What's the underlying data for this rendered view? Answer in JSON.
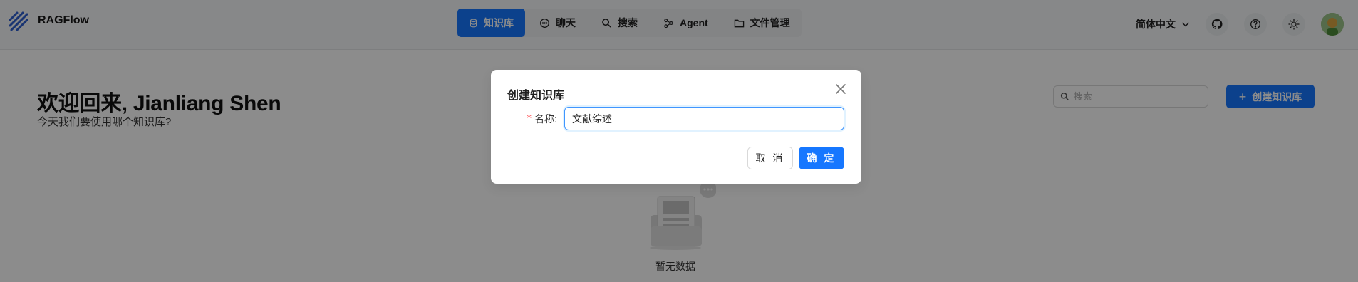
{
  "header": {
    "brand": "RAGFlow",
    "nav": [
      {
        "label": "知识库",
        "icon": "database-icon",
        "active": true
      },
      {
        "label": "聊天",
        "icon": "chat-icon",
        "active": false
      },
      {
        "label": "搜索",
        "icon": "search-icon",
        "active": false
      },
      {
        "label": "Agent",
        "icon": "agent-graph-icon",
        "active": false
      },
      {
        "label": "文件管理",
        "icon": "folder-icon",
        "active": false
      }
    ],
    "language": "简体中文",
    "icons": [
      "github-icon",
      "help-icon",
      "theme-sun-icon"
    ]
  },
  "main": {
    "welcome": "欢迎回来, Jianliang Shen",
    "subtitle": "今天我们要使用哪个知识库?",
    "search_placeholder": "搜索",
    "create_button": "创建知识库",
    "empty_text": "暂无数据"
  },
  "modal": {
    "title": "创建知识库",
    "name_label": "名称:",
    "name_value": "文献综述",
    "cancel_label": "取 消",
    "ok_label": "确 定"
  },
  "colors": {
    "accent": "#1677ff",
    "required": "#ff4d4f",
    "overlay": "rgba(0,0,0,0.45)"
  }
}
